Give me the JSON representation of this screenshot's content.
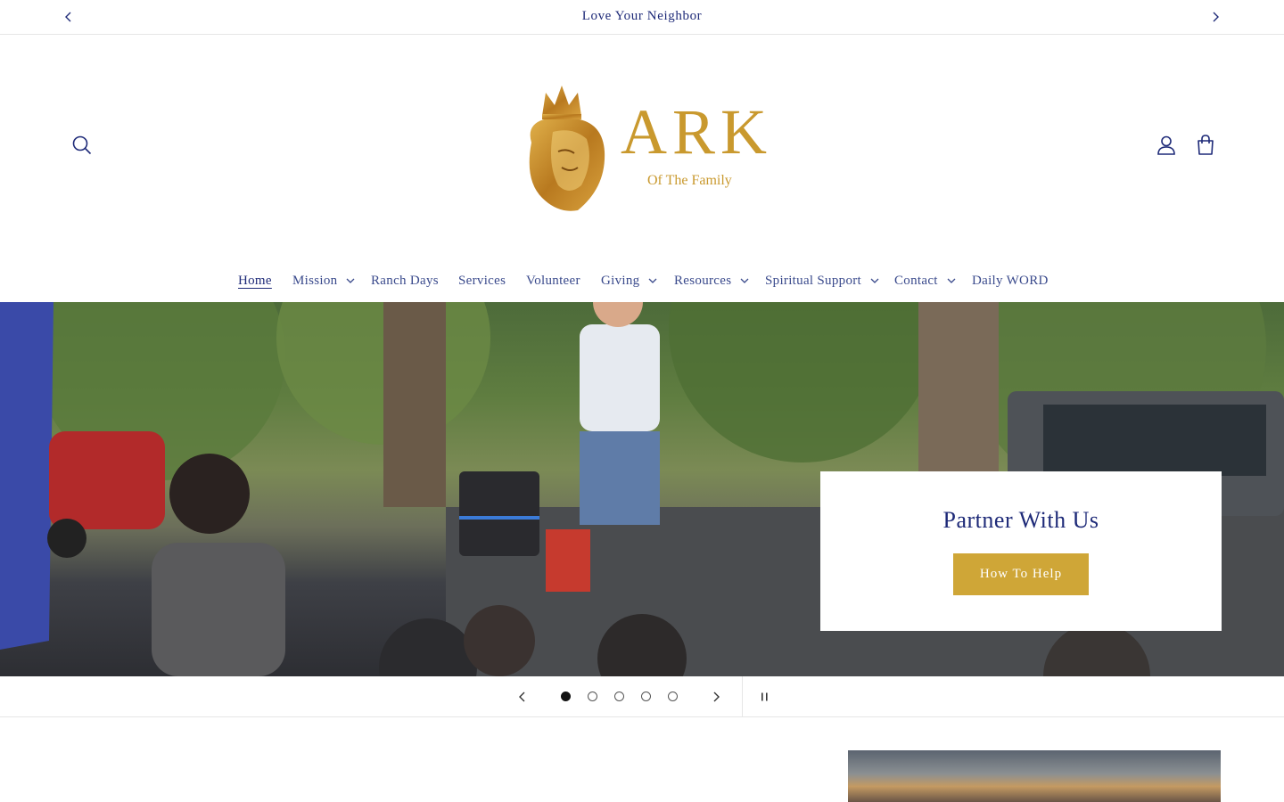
{
  "announcement": {
    "text": "Love Your Neighbor",
    "prev_icon": "chevron-left-icon",
    "next_icon": "chevron-right-icon"
  },
  "header": {
    "search_icon": "search-icon",
    "account_icon": "user-icon",
    "cart_icon": "cart-icon",
    "logo": {
      "wordmark": "ARK",
      "tagline": "Of The Family",
      "emblem": "crowned-lion-icon",
      "color": "#c08a2e"
    }
  },
  "nav": {
    "items": [
      {
        "label": "Home",
        "active": true,
        "dropdown": false
      },
      {
        "label": "Mission",
        "active": false,
        "dropdown": true
      },
      {
        "label": "Ranch Days",
        "active": false,
        "dropdown": false
      },
      {
        "label": "Services",
        "active": false,
        "dropdown": false
      },
      {
        "label": "Volunteer",
        "active": false,
        "dropdown": false
      },
      {
        "label": "Giving",
        "active": false,
        "dropdown": true
      },
      {
        "label": "Resources",
        "active": false,
        "dropdown": true
      },
      {
        "label": "Spiritual Support",
        "active": false,
        "dropdown": true
      },
      {
        "label": "Contact",
        "active": false,
        "dropdown": true
      },
      {
        "label": "Daily WORD",
        "active": false,
        "dropdown": false
      }
    ]
  },
  "hero": {
    "heading": "Partner With Us",
    "button_label": "How To Help",
    "button_color": "#cfa637"
  },
  "slideshow": {
    "slide_count": 5,
    "current_slide": 1,
    "pause_icon": "pause-icon"
  },
  "colors": {
    "text_primary": "#1e2a78",
    "nav_text": "#3a4a8c",
    "accent_gold": "#cfa637",
    "border": "#e6e6e6"
  }
}
